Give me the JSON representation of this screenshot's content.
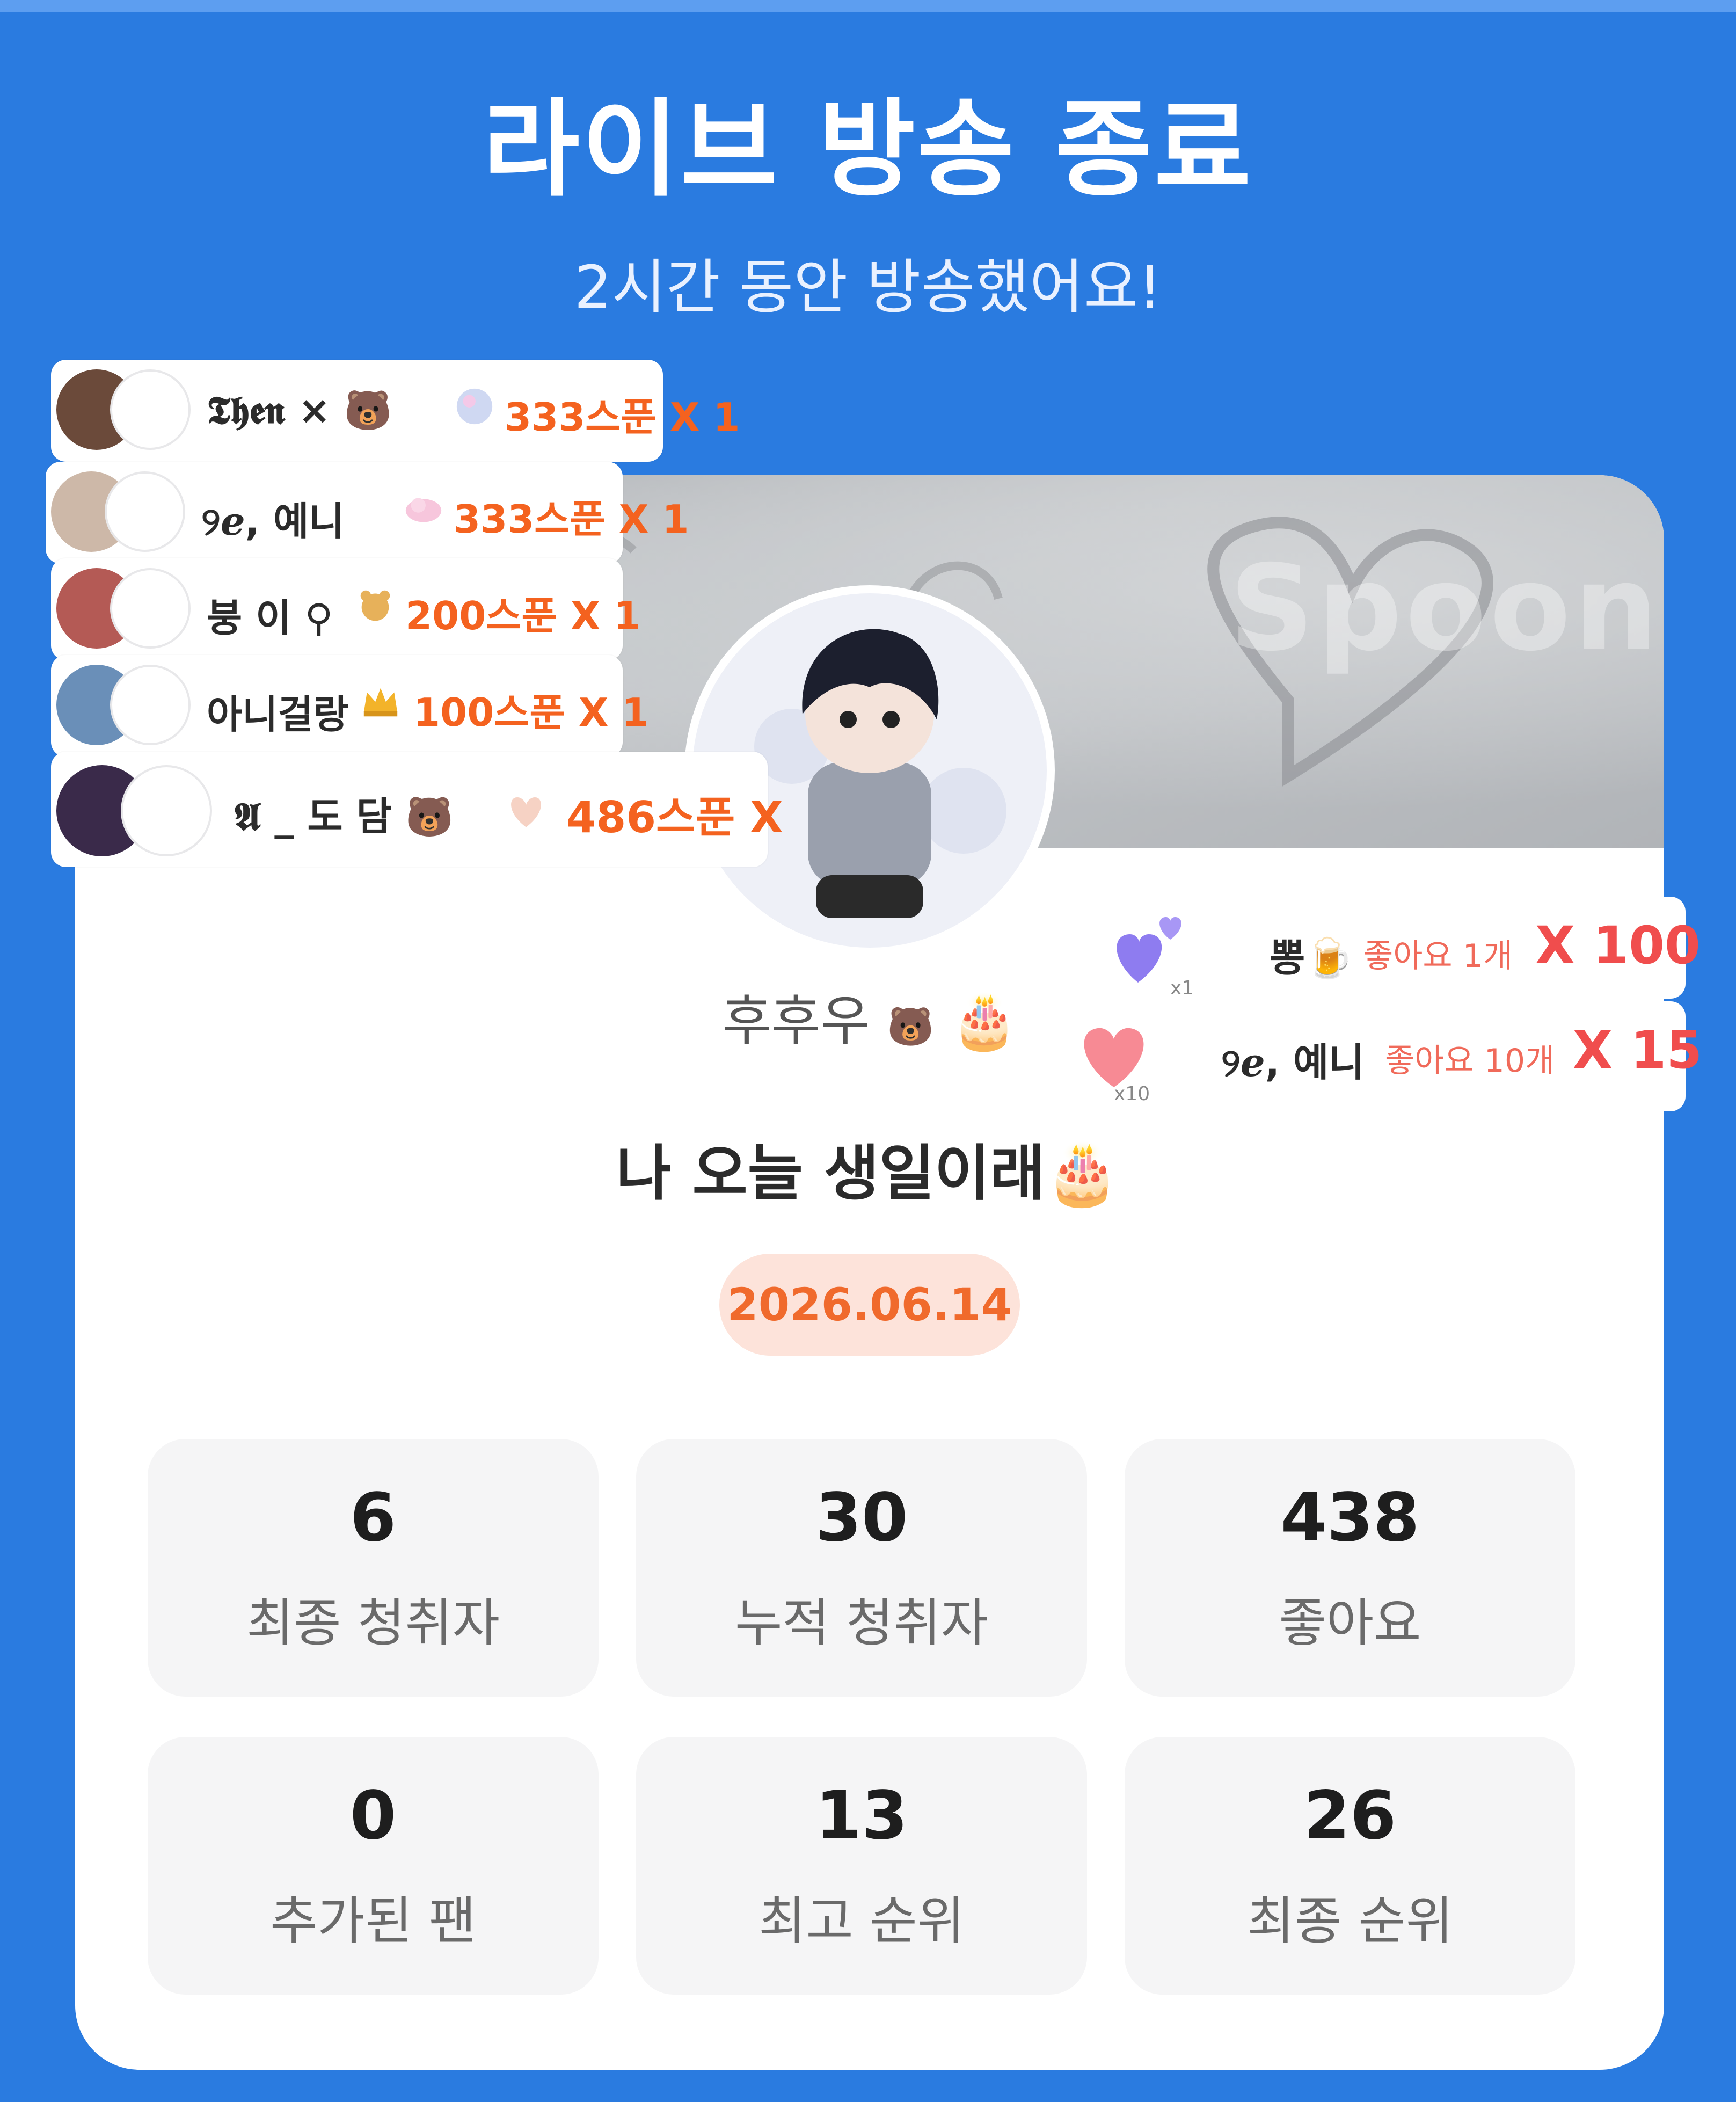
{
  "header": {
    "title": "라이브 방송 종료",
    "subtitle": "2시간 동안 방송했어요!"
  },
  "banner": {
    "watermark": "Spoon"
  },
  "host": {
    "name": "후후우",
    "name_badge": "🐻",
    "name_emoji": "🎂"
  },
  "broadcast": {
    "title": "나 오늘 생일이래🎂",
    "date": "2026.06.14"
  },
  "gifts": [
    {
      "user": "𝕿𝖍𝖊𝖓 × 🐻",
      "icon": "crystal-ball-icon",
      "amount": "333스푼 X 1"
    },
    {
      "user": "୨ℯ, 예니",
      "icon": "pink-cloud-icon",
      "amount": "333스푼 X 1"
    },
    {
      "user": "붕 이 ⚲",
      "icon": "bear-icon",
      "amount": "200스푼 X 1"
    },
    {
      "user": "아니걸랑",
      "icon": "crown-icon",
      "amount": "100스푼 X 1"
    },
    {
      "user": "𝕬 _ 도 담 🐻",
      "icon": "heart-hands-icon",
      "amount": "486스푼 X"
    }
  ],
  "likes": [
    {
      "user": "뽕🍺",
      "icon": "purple-hearts-icon",
      "icon_badge": "x1",
      "label": "좋아요 1개",
      "mult": "X 100"
    },
    {
      "user": "୨ℯ, 예니",
      "icon": "pink-heart-icon",
      "icon_badge": "x10",
      "label": "좋아요 10개",
      "mult": "X 15"
    }
  ],
  "stats": [
    {
      "value": "6",
      "label": "최종 청취자"
    },
    {
      "value": "30",
      "label": "누적 청취자"
    },
    {
      "value": "438",
      "label": "좋아요"
    },
    {
      "value": "0",
      "label": "추가된 팬"
    },
    {
      "value": "13",
      "label": "최고 순위"
    },
    {
      "value": "26",
      "label": "최종 순위"
    }
  ],
  "colors": {
    "background": "#2a7be0",
    "accent_orange": "#f4621f",
    "date_pill_bg": "#fde3da",
    "like_red": "#f04d4d"
  }
}
